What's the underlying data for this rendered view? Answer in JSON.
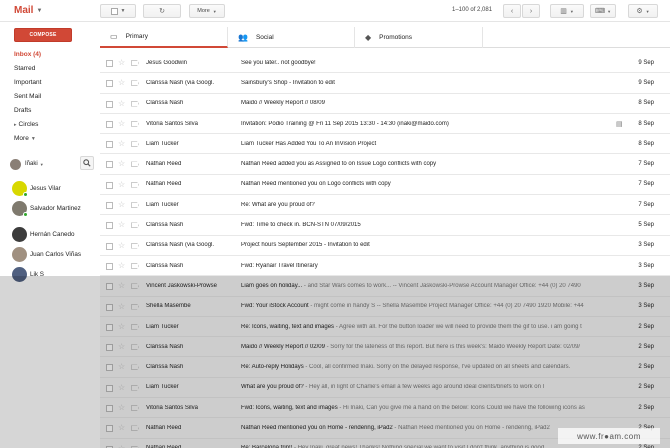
{
  "app": {
    "logo": "Mail"
  },
  "toolbar": {
    "refresh_icon": "refresh-icon",
    "more_label": "More",
    "page_count": "1–100 of 2,081"
  },
  "sidebar": {
    "compose_label": "COMPOSE",
    "items": [
      {
        "label": "Inbox (4)",
        "active": true
      },
      {
        "label": "Starred"
      },
      {
        "label": "Important"
      },
      {
        "label": "Sent Mail"
      },
      {
        "label": "Drafts"
      },
      {
        "label": "Circles"
      },
      {
        "label": "More"
      }
    ]
  },
  "chat": {
    "me": "Iñaki",
    "contacts": [
      {
        "name": "Jesus Vilar",
        "online": true,
        "color": "#d8d800"
      },
      {
        "name": "Salvador Martinez",
        "online": true,
        "color": "#7f7a6e"
      },
      {
        "name": "Hernán Canedo",
        "online": false,
        "color": "#3c3c3c"
      },
      {
        "name": "Juan Carlos Viñas",
        "online": false,
        "color": "#a09080"
      },
      {
        "name": "Lik S",
        "online": false,
        "color": "#506080"
      }
    ]
  },
  "tabs": [
    {
      "label": "Primary",
      "icon": "inbox-icon"
    },
    {
      "label": "Social",
      "icon": "people-icon"
    },
    {
      "label": "Promotions",
      "icon": "tag-icon"
    }
  ],
  "emails": [
    {
      "sender": "Jesus Goodwin",
      "subject": "See you later.. not goodbye!",
      "snippet": "",
      "date": "9 Sep"
    },
    {
      "sender": "Clarissa Nash (via Googl.",
      "subject": "Sainsbury's Shop - Invitation to edit",
      "snippet": "",
      "date": "9 Sep"
    },
    {
      "sender": "Clarissa Nash",
      "subject": "Maido // Weekly Report // 08/09",
      "snippet": "",
      "date": "8 Sep"
    },
    {
      "sender": "Vitoria Santos Silva",
      "subject": "Invitation: Podio Training @ Fri 11 Sep 2015 13:30 - 14:30 (inaki@maido.com)",
      "snippet": "",
      "date": "8 Sep",
      "attachment": true
    },
    {
      "sender": "Liam Tucker",
      "subject": "Liam Tucker Has Added You To An InVision Project",
      "snippet": "",
      "date": "8 Sep"
    },
    {
      "sender": "Nathan Reed",
      "subject": "Nathan Reed added you as Assigned to on Issue Logo conflicts with copy",
      "snippet": "",
      "date": "7 Sep"
    },
    {
      "sender": "Nathan Reed",
      "subject": "Nathan Reed mentioned you on Logo conflicts with copy",
      "snippet": "",
      "date": "7 Sep"
    },
    {
      "sender": "Liam Tucker",
      "subject": "Re: What are you proud of?",
      "snippet": "",
      "date": "7 Sep"
    },
    {
      "sender": "Clarissa Nash",
      "subject": "Fwd: Time to check in. BCN-STN 07/09/2015",
      "snippet": "",
      "date": "5 Sep"
    },
    {
      "sender": "Clarissa Nash (via Googl.",
      "subject": "Project hours September 2015 - Invitation to edit",
      "snippet": "",
      "date": "3 Sep"
    },
    {
      "sender": "Clarissa Nash",
      "subject": "Fwd: Ryanair Travel Itinerary",
      "snippet": "",
      "date": "3 Sep"
    },
    {
      "sender": "Vincent Jaskowski-Prowse",
      "subject": "Liam goes on holiday...",
      "snippet": " - and Star Wars comes to work... -- Vincent Jaskowski-Prowse Account Manager Office: +44 (0) 20 7490",
      "date": "3 Sep",
      "read": true
    },
    {
      "sender": "Shella Masembe",
      "subject": "Fwd: Your iStock Account",
      "snippet": " - might come in handy S -- Shella Masembe Project Manager Office: +44 (0) 20 7490 1920 Mobile: +44",
      "date": "3 Sep",
      "read": true
    },
    {
      "sender": "Liam Tucker",
      "subject": "Re: Icons, waiting, text and images",
      "snippet": " - Agree with all. For the button loader we will need to provide them the gif to use. i am going t",
      "date": "2 Sep",
      "read": true
    },
    {
      "sender": "Clarissa Nash",
      "subject": "Maido // Weekly Report // 02/09",
      "snippet": " - Sorry for the lateness of this report. But here is this week's: Maido Weekly Report Date: 02/09/",
      "date": "2 Sep",
      "read": true
    },
    {
      "sender": "Clarissa Nash",
      "subject": "Re: Auto-reply Holidays",
      "snippet": " - Cool, all confirmed Inaki. Sorry on the delayed response, I've updated on all sheets and calendars.",
      "date": "2 Sep",
      "read": true
    },
    {
      "sender": "Liam Tucker",
      "subject": "What are you proud of?",
      "snippet": " - Hey all, in light of Charlie's email a few weeks ago around ideal clients/briefs to work on I",
      "date": "2 Sep",
      "read": true
    },
    {
      "sender": "Vitoria Santos Silva",
      "subject": "Fwd: Icons, waiting, text and images",
      "snippet": " - Hi Inaki, Can you give me a hand on the below: Icons Could we have the following icons as",
      "date": "2 Sep",
      "read": true
    },
    {
      "sender": "Nathan Reed",
      "subject": "Nathan Reed mentioned you on Home - rendering, iPad2",
      "snippet": " - Nathan Reed mentioned you on Home - rendering, iPad2",
      "date": "2 Sep",
      "read": true
    },
    {
      "sender": "Nathan Reed",
      "subject": "Re: Barcelona trip!!",
      "snippet": " - Hey Inaki, great news! Thanks! Nothing special we want to visit I don't think, anything is good",
      "date": "2 Sep",
      "read": true
    }
  ],
  "watermark": "www.fr●am.com"
}
